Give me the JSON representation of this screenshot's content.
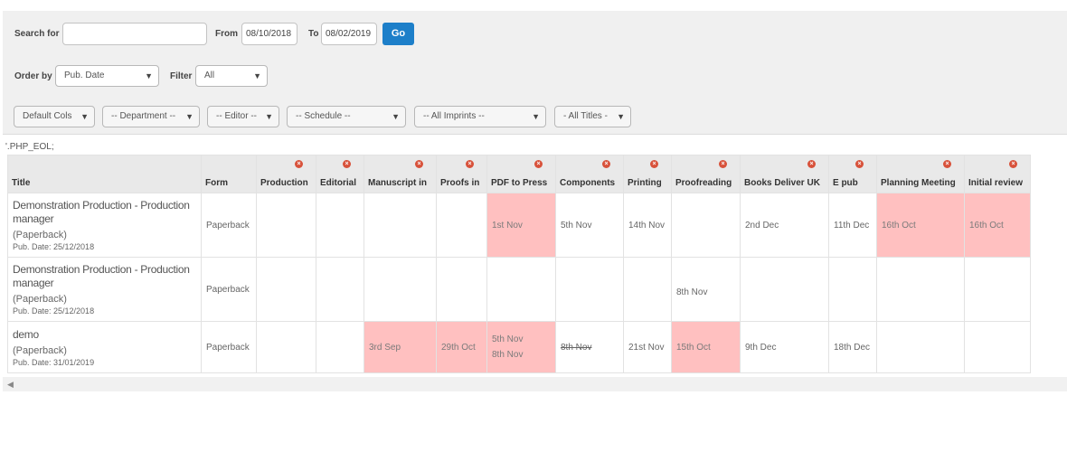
{
  "search": {
    "label": "Search for",
    "value": "",
    "from_label": "From",
    "from_value": "08/10/2018",
    "to_label": "To",
    "to_value": "08/02/2019",
    "go_label": "Go"
  },
  "order": {
    "label": "Order by",
    "value": "Pub. Date",
    "filter_label": "Filter",
    "filter_value": "All"
  },
  "selects": {
    "cols": "Default Cols",
    "department": "-- Department --",
    "editor": "-- Editor --",
    "schedule": "-- Schedule --",
    "imprints": "-- All Imprints --",
    "titles": "- All Titles -"
  },
  "php_eol": "'.PHP_EOL;",
  "columns": [
    "Title",
    "Form",
    "Production",
    "Editorial",
    "Manuscript in",
    "Proofs in",
    "PDF to Press",
    "Components",
    "Printing",
    "Proofreading",
    "Books Deliver UK",
    "E pub",
    "Planning Meeting",
    "Initial review"
  ],
  "rows": [
    {
      "title": "Demonstration Production - Production manager",
      "format": "(Paperback)",
      "pubdate": "Pub. Date: 25/12/2018",
      "form": "Paperback",
      "production": "",
      "editorial": "",
      "manuscript": "",
      "proofs": "",
      "pdf1": "1st Nov",
      "pdf2": "",
      "components": "5th Nov",
      "printing": "14th Nov",
      "proofreading": "",
      "books": "2nd Dec",
      "epub": "11th Dec",
      "planning": "16th Oct",
      "initial": "16th Oct"
    },
    {
      "title": "Demonstration Production - Production manager",
      "format": "(Paperback)",
      "pubdate": "Pub. Date: 25/12/2018",
      "form": "Paperback",
      "production": "",
      "editorial": "",
      "manuscript": "",
      "proofs": "",
      "pdf1": "",
      "pdf2": "",
      "components": "",
      "printing": "",
      "proofreading": "8th Nov",
      "books": "",
      "epub": "",
      "planning": "",
      "initial": ""
    },
    {
      "title": "demo",
      "format": "(Paperback)",
      "pubdate": "Pub. Date: 31/01/2019",
      "form": "Paperback",
      "production": "",
      "editorial": "",
      "manuscript": "3rd Sep",
      "proofs": "29th Oct",
      "pdf1": "5th Nov",
      "pdf2": "8th Nov",
      "components": "8th Nov",
      "printing": "21st Nov",
      "proofreading": "15th Oct",
      "books": "9th Dec",
      "epub": "18th Dec",
      "planning": "",
      "initial": ""
    }
  ],
  "colors": {
    "go": "#1d7fc9",
    "highlight": "#ffc0c0",
    "remove_icon": "#d8523b"
  }
}
